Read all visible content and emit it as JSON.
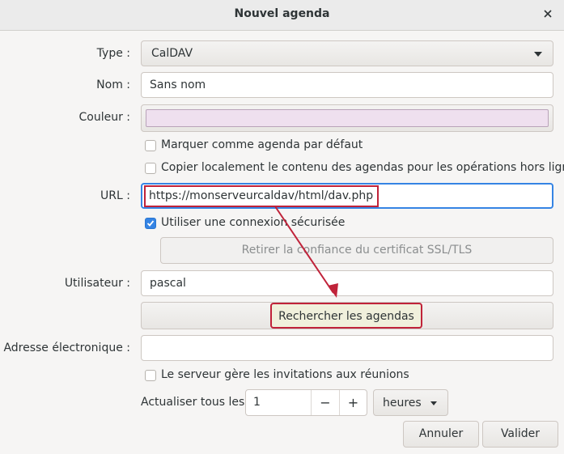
{
  "dialog": {
    "title": "Nouvel agenda"
  },
  "labels": {
    "type": "Type :",
    "nom": "Nom :",
    "couleur": "Couleur :",
    "url": "URL :",
    "utilisateur": "Utilisateur :",
    "adresse": "Adresse électronique :",
    "actualiser": "Actualiser tous les"
  },
  "fields": {
    "type_value": "CalDAV",
    "nom_value": "Sans nom",
    "couleur_value": "#efe0ef",
    "url_value": "https://monserveurcaldav/html/dav.php",
    "utilisateur_value": "pascal",
    "adresse_value": "",
    "refresh_value": "1",
    "refresh_unit": "heures"
  },
  "checkboxes": {
    "defaut": {
      "label": "Marquer comme agenda par défaut",
      "checked": false
    },
    "offline": {
      "label": "Copier localement le contenu des agendas pour les opérations hors ligne",
      "checked": false
    },
    "secure": {
      "label": "Utiliser une connexion sécurisée",
      "checked": true
    },
    "invitations": {
      "label": "Le serveur gère les invitations aux réunions",
      "checked": false
    }
  },
  "buttons": {
    "ssl": "Retirer la confiance du certificat SSL/TLS",
    "rechercher": "Rechercher les agendas",
    "annuler": "Annuler",
    "valider": "Valider",
    "minus": "−",
    "plus": "+"
  },
  "colors": {
    "accent": "#3584e4",
    "highlight": "#c0233a"
  },
  "icons": {
    "close": "close-icon",
    "dropdown": "chevron-down-icon",
    "check": "check-icon"
  }
}
